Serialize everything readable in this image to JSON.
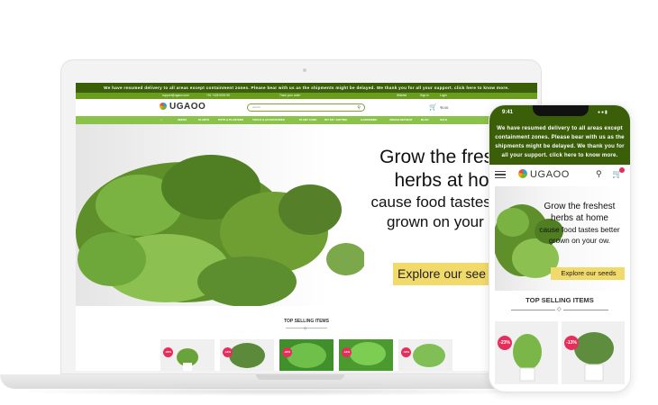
{
  "desktop": {
    "announcement": "We have resumed delivery to all areas except containment zones. Please bear with us as the shipments might be delayed. We thank you for all your support. click here to know more.",
    "contact": {
      "email": "support@ugaoo.com",
      "phone": "+91 7428 9000 95",
      "order_text": "Track your order",
      "wishlist": "Wishlist",
      "signin": "Sign in",
      "login": "Login"
    },
    "logo": "UGAOO",
    "search_placeholder": "search",
    "cart_price": "₹0.00",
    "nav": [
      "SEEDS",
      "PLANTS",
      "POTS & PLANTERS",
      "TOOLS & ACCESSORIES",
      "PLANT CARE",
      "DIY KIT / GIFTING",
      "GARDENING",
      "URBAN RETREAT",
      "BLOG",
      "SALE"
    ],
    "hero": {
      "line1": "Grow the fresh",
      "line2": "herbs at ho",
      "line3": "cause food tastes be",
      "line4": "grown on your o",
      "cta": "Explore our see"
    },
    "section_title": "TOP SELLING ITEMS",
    "badges": [
      "-23%",
      "-13%",
      "-22%",
      "-14%",
      "-18%"
    ]
  },
  "phone": {
    "time": "9:41",
    "announcement": "We have resumed delivery to all areas except containment zones. Please bear with us as the shipments might be delayed. We thank you for all your support. click here to know more.",
    "logo": "UGAOO",
    "hero": {
      "line1": "Grow the freshest",
      "line2": "herbs at home",
      "line3": "cause food tastes better",
      "line4": "grown on your ow.",
      "cta": "Explore our seeds"
    },
    "section_title": "TOP SELLING ITEMS",
    "badges": [
      "-23%",
      "-13%"
    ]
  },
  "colors": {
    "dark_green": "#3b5e08",
    "nav_green": "#8bc34a",
    "cta_yellow": "#f2da6a",
    "badge_pink": "#e52e5c"
  },
  "icons": [
    "search-icon",
    "cart-icon",
    "hamburger-menu-icon",
    "diamond-divider-icon"
  ]
}
